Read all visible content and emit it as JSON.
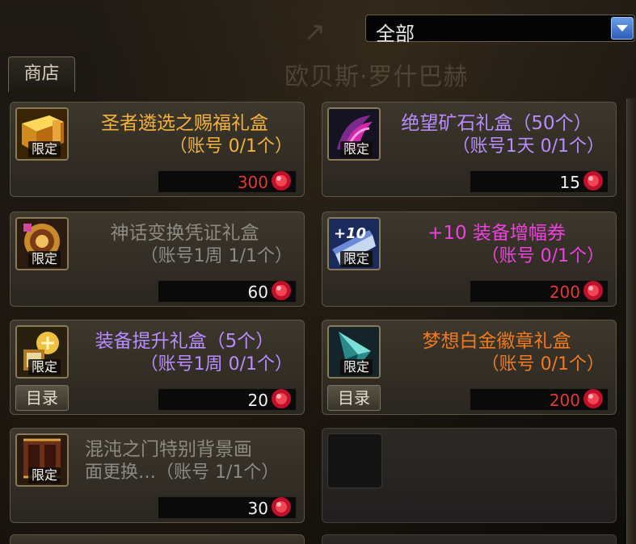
{
  "header": {
    "bg_title": "欧贝斯·罗什巴赫",
    "filter_value": "全部",
    "shop_tab_label": "商店"
  },
  "cards": [
    {
      "name": "圣者遴选之赐福礼盒",
      "limit": "（账号 0/1个）",
      "price": "300",
      "limited_label": "限定",
      "name_color": "#f1b13d",
      "limit_color": "#f1b13d",
      "price_color": "#e23a32",
      "icon": "gold-box-icon"
    },
    {
      "name": "绝望矿石礼盒（50个）",
      "limit": "（账号1天 0/1个）",
      "price": "15",
      "limited_label": "限定",
      "name_color": "#b98cff",
      "limit_color": "#b98cff",
      "price_color": "#f2f2f2",
      "icon": "ore-claw-icon"
    },
    {
      "name": "神话变换凭证礼盒",
      "limit": "（账号1周 1/1个）",
      "price": "60",
      "limited_label": "限定",
      "name_color": "#8d8a84",
      "limit_color": "#8d8a84",
      "price_color": "#f2f2f2",
      "icon": "myth-voucher-icon"
    },
    {
      "name": "+10 装备增幅券",
      "limit": "（账号 0/1个）",
      "price": "200",
      "limited_label": "限定",
      "name_color": "#f040e0",
      "limit_color": "#f040e0",
      "price_color": "#e23a32",
      "icon": "plus10-ticket-icon",
      "ticket_text": "+10"
    },
    {
      "name": "装备提升礼盒（5个）",
      "limit": "（账号1周 0/1个）",
      "price": "20",
      "limited_label": "限定",
      "catalog_label": "目录",
      "name_color": "#b98cff",
      "limit_color": "#b98cff",
      "price_color": "#f2f2f2",
      "icon": "upgrade-box-icon"
    },
    {
      "name": "梦想白金徽章礼盒",
      "limit": "（账号 0/1个）",
      "price": "200",
      "limited_label": "限定",
      "catalog_label": "目录",
      "name_color": "#f07a22",
      "limit_color": "#f07a22",
      "price_color": "#e23a32",
      "icon": "platinum-emblem-icon"
    },
    {
      "name": "混沌之门特别背景画",
      "name2": "面更换…（账号 1/1个）",
      "price": "30",
      "limited_label": "限定",
      "name_color": "#8d8a84",
      "limit_color": "#8d8a84",
      "price_color": "#f2f2f2",
      "icon": "chaos-gate-icon"
    }
  ]
}
